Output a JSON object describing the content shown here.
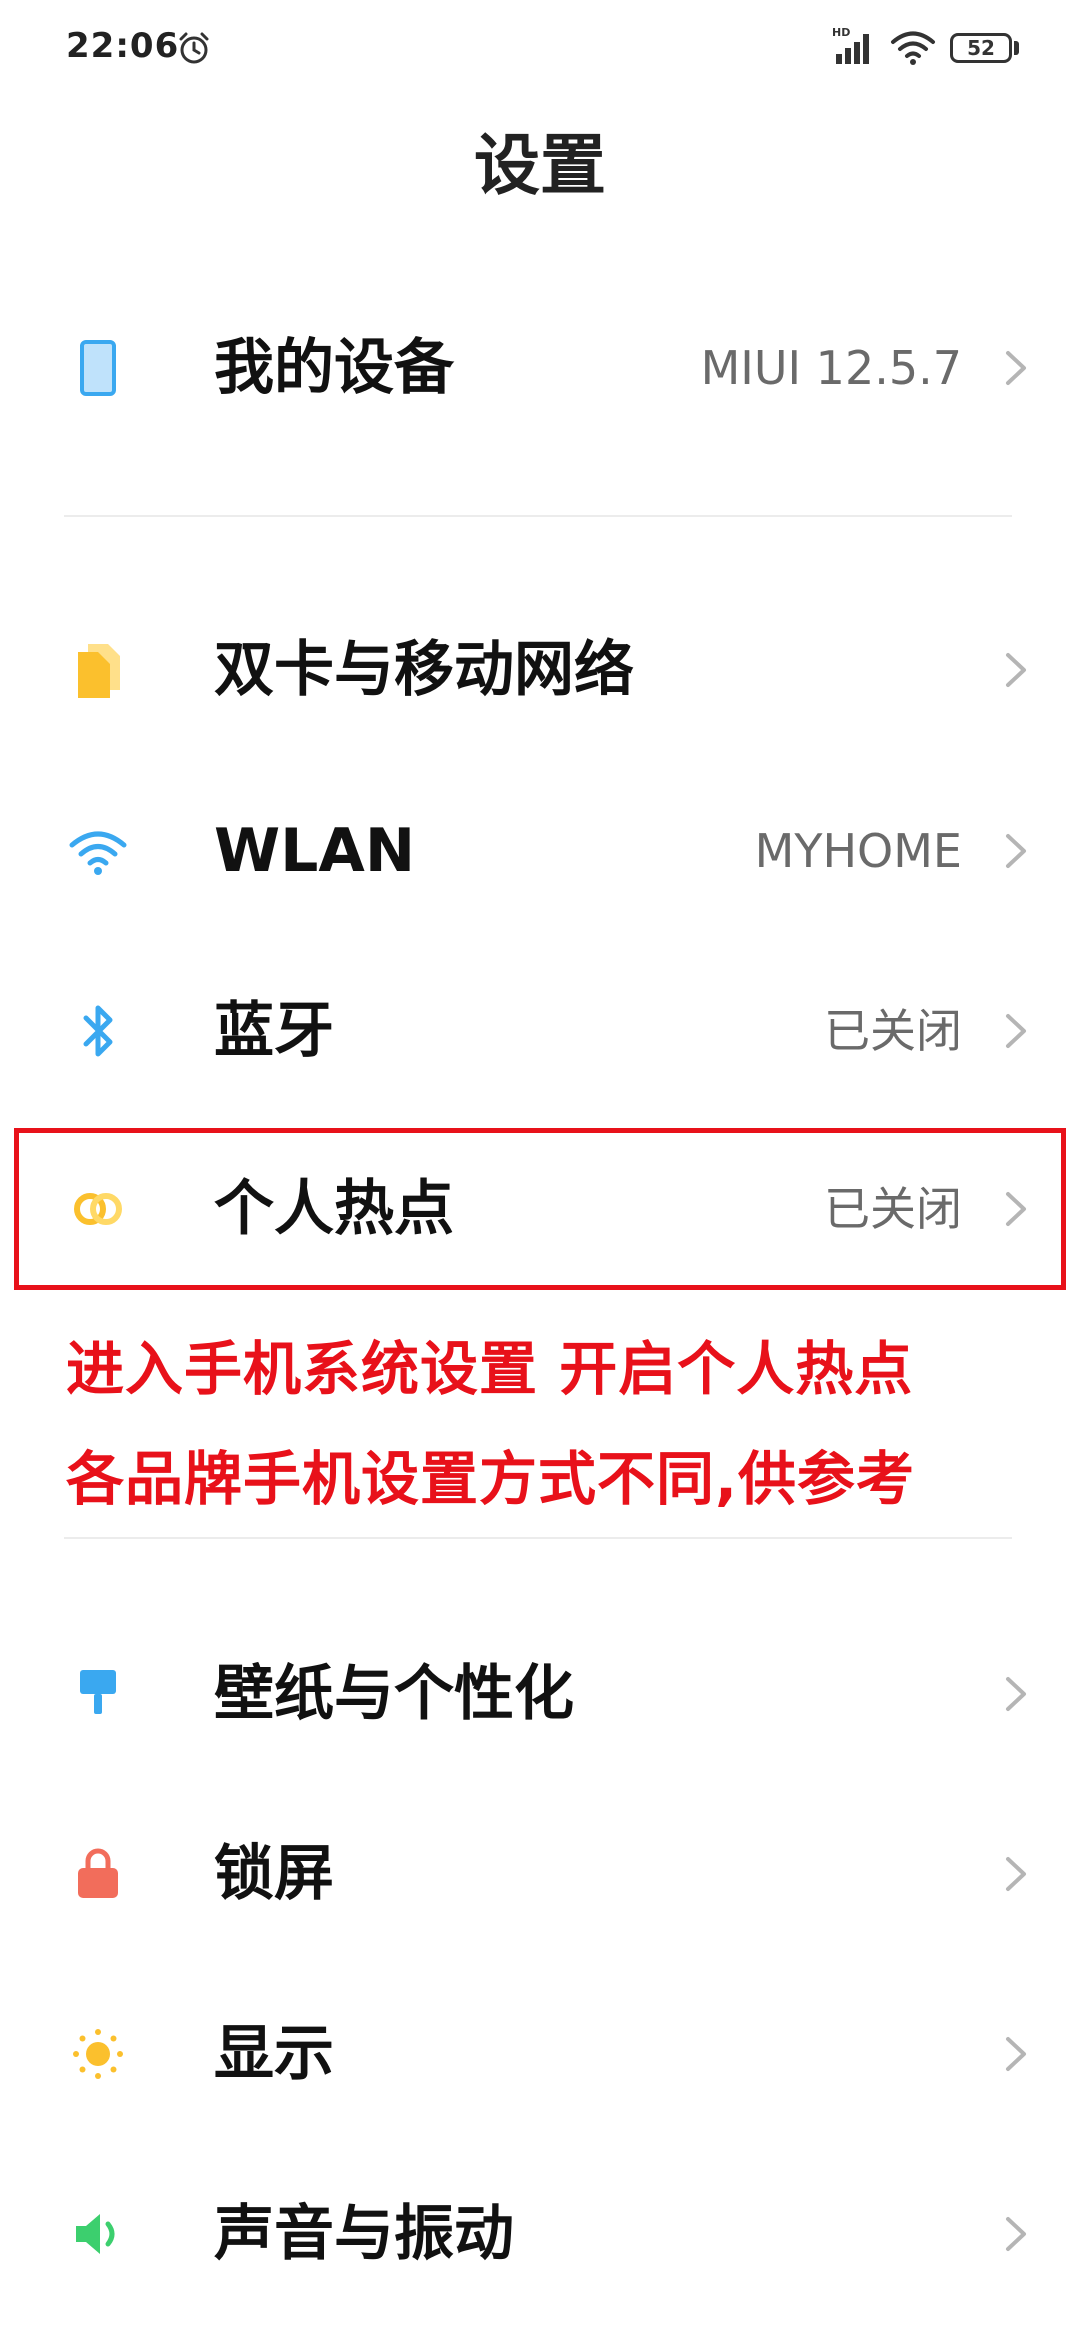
{
  "status_bar": {
    "time": "22:06",
    "network_badge": "HD",
    "battery_level": "52",
    "icons": [
      "alarm-icon",
      "signal-icon",
      "wifi-icon",
      "battery-icon"
    ]
  },
  "page": {
    "title": "设置"
  },
  "items": [
    {
      "id": "my-device",
      "label": "我的设备",
      "value": "MIUI 12.5.7",
      "icon": "device-icon",
      "icon_color": "#3aa8f0"
    },
    {
      "id": "dual-sim",
      "label": "双卡与移动网络",
      "value": "",
      "icon": "sim-card-icon",
      "icon_color": "#fbc02d"
    },
    {
      "id": "wlan",
      "label": "WLAN",
      "value": "MYHOME",
      "icon": "wifi-icon",
      "icon_color": "#3aa8f0"
    },
    {
      "id": "bluetooth",
      "label": "蓝牙",
      "value": "已关闭",
      "icon": "bluetooth-icon",
      "icon_color": "#3aa8f0"
    },
    {
      "id": "hotspot",
      "label": "个人热点",
      "value": "已关闭",
      "icon": "hotspot-icon",
      "icon_color": "#fbc02d"
    },
    {
      "id": "wallpaper",
      "label": "壁纸与个性化",
      "value": "",
      "icon": "paint-brush-icon",
      "icon_color": "#3aa8f0"
    },
    {
      "id": "lock-screen",
      "label": "锁屏",
      "value": "",
      "icon": "lock-icon",
      "icon_color": "#f26d5b"
    },
    {
      "id": "display",
      "label": "显示",
      "value": "",
      "icon": "sun-icon",
      "icon_color": "#fbc02d"
    },
    {
      "id": "sound",
      "label": "声音与振动",
      "value": "",
      "icon": "speaker-icon",
      "icon_color": "#3ccf6e"
    }
  ],
  "annotation": {
    "line1": "进入手机系统设置 开启个人热点",
    "line2": "各品牌手机设置方式不同,供参考",
    "color": "#e8111a"
  }
}
